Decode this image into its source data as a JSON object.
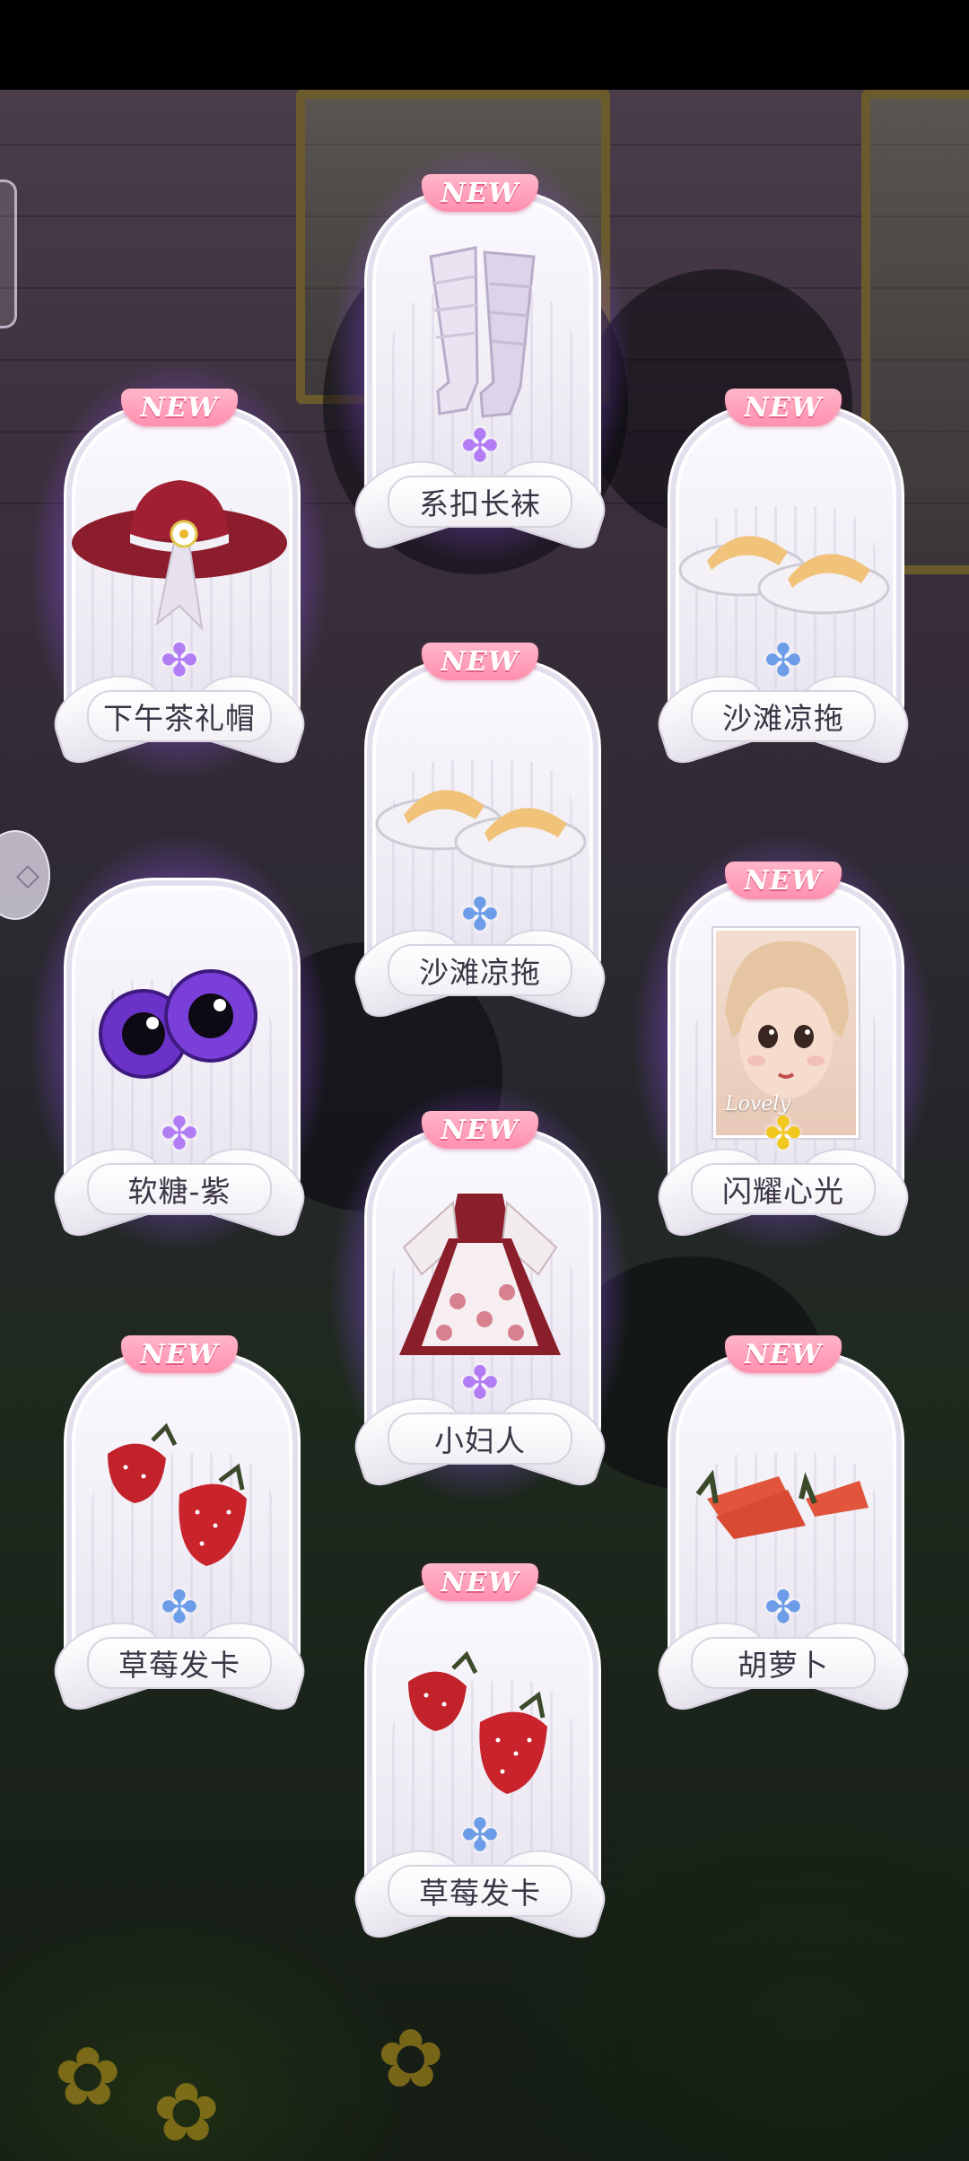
{
  "new_badge": "NEW",
  "cards": [
    {
      "id": "socks",
      "label": "系扣长袜",
      "gem": "purple",
      "glow": true
    },
    {
      "id": "hat",
      "label": "下午茶礼帽",
      "gem": "purple",
      "glow": true
    },
    {
      "id": "slippers-right",
      "label": "沙滩凉拖",
      "gem": "blue",
      "glow": false
    },
    {
      "id": "slippers-center",
      "label": "沙滩凉拖",
      "gem": "blue",
      "glow": false
    },
    {
      "id": "eyes",
      "label": "软糖-紫",
      "gem": "purple",
      "glow": true
    },
    {
      "id": "makeup",
      "label": "闪耀心光",
      "gem": "gold",
      "glow": true,
      "portrait_text": "Lovely"
    },
    {
      "id": "dress",
      "label": "小妇人",
      "gem": "purple",
      "glow": true
    },
    {
      "id": "strawberry-left",
      "label": "草莓发卡",
      "gem": "blue",
      "glow": false
    },
    {
      "id": "carrot",
      "label": "胡萝卜",
      "gem": "blue",
      "glow": false
    },
    {
      "id": "strawberry-bottom",
      "label": "草莓发卡",
      "gem": "blue",
      "glow": false
    }
  ],
  "colors": {
    "purple_glow": "#a86cff",
    "pink_ribbon": "#ff8fae",
    "gem_purple": "#b27cf4",
    "gem_blue": "#6d9de8",
    "gem_gold": "#f2c81f"
  },
  "icons": {
    "side_arrow": "chevron-right-icon",
    "gem": "four-petal-flower-icon"
  }
}
